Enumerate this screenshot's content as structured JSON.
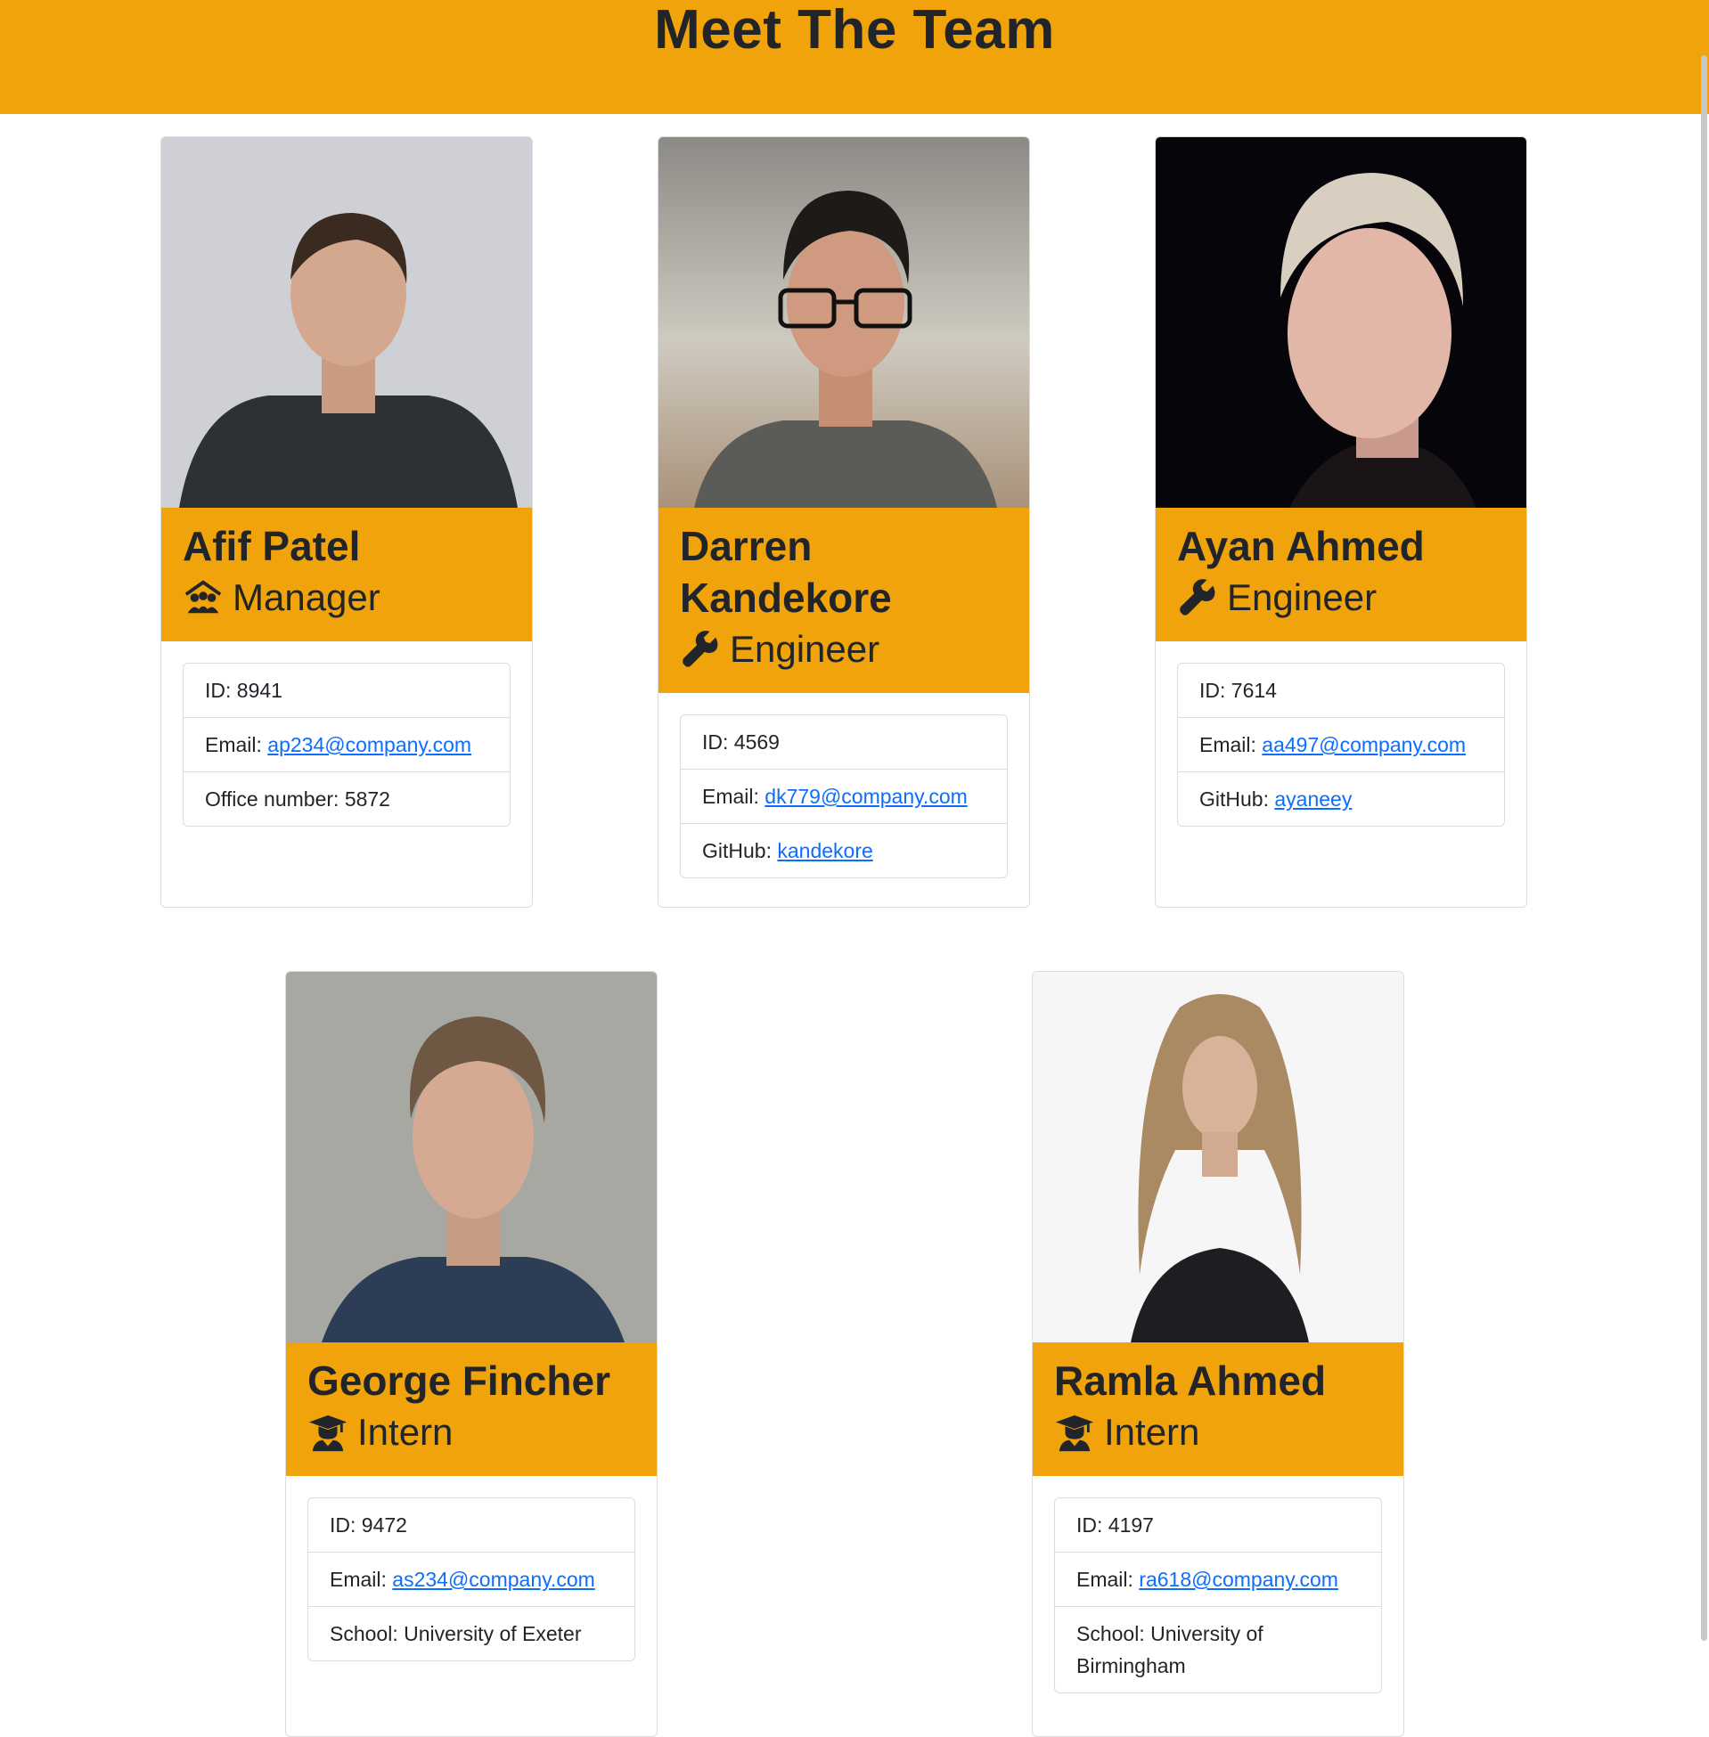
{
  "page": {
    "title": "Meet The Team"
  },
  "team": [
    {
      "name": "Afif Patel",
      "role": "Manager",
      "role_icon": "manager-people-icon",
      "id_label": "ID:",
      "id": "8941",
      "email_label": "Email:",
      "email": "ap234@company.com",
      "extra_label": "Office number:",
      "extra": "5872",
      "photo": "photo-man-dark-shirt"
    },
    {
      "name": "Darren Kandekore",
      "role": "Engineer",
      "role_icon": "wrench-icon",
      "id_label": "ID:",
      "id": "4569",
      "email_label": "Email:",
      "email": "dk779@company.com",
      "extra_label": "GitHub:",
      "extra": "kandekore",
      "photo": "photo-man-glasses"
    },
    {
      "name": "Ayan Ahmed",
      "role": "Engineer",
      "role_icon": "wrench-icon",
      "id_label": "ID:",
      "id": "7614",
      "email_label": "Email:",
      "email": "aa497@company.com",
      "extra_label": "GitHub:",
      "extra": "ayaneey",
      "photo": "photo-woman-short-hair"
    },
    {
      "name": "George Fincher",
      "role": "Intern",
      "role_icon": "graduate-icon",
      "id_label": "ID:",
      "id": "9472",
      "email_label": "Email:",
      "email": "as234@company.com",
      "extra_label": "School:",
      "extra": "University of Exeter",
      "photo": "photo-man-blue-shirt"
    },
    {
      "name": "Ramla Ahmed",
      "role": "Intern",
      "role_icon": "graduate-icon",
      "id_label": "ID:",
      "id": "4197",
      "email_label": "Email:",
      "email": "ra618@company.com",
      "extra_label": "School:",
      "extra": "University of Birmingham",
      "photo": "photo-woman-long-hair"
    }
  ],
  "colors": {
    "accent": "#f0a30a",
    "link": "#0d6efd",
    "text": "#212529"
  }
}
